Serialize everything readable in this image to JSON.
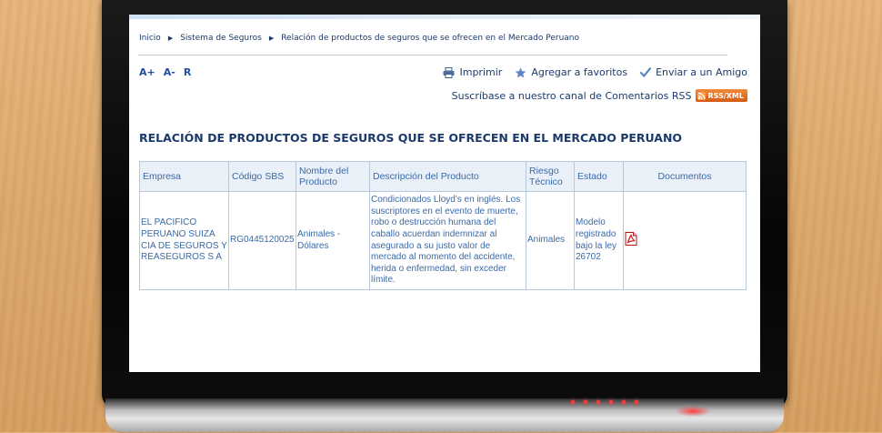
{
  "breadcrumb": [
    "Inicio",
    "Sistema de Seguros",
    "Relación de productos de seguros que se ofrecen en el Mercado Peruano"
  ],
  "font_controls": [
    "A+",
    "A-",
    "R"
  ],
  "actions": {
    "print": "Imprimir",
    "favorites": "Agregar a favoritos",
    "send": "Enviar a un Amigo"
  },
  "rss": {
    "label": "Suscríbase a nuestro canal de Comentarios RSS",
    "badge": "RSS/XML"
  },
  "page_title": "RELACIÓN DE PRODUCTOS DE SEGUROS QUE SE OFRECEN EN EL MERCADO PERUANO",
  "table": {
    "headers": [
      "Empresa",
      "Código SBS",
      "Nombre del Producto",
      "Descripción del Producto",
      "Riesgo Técnico",
      "Estado",
      "Documentos"
    ],
    "rows": [
      {
        "empresa": "EL PACIFICO PERUANO SUIZA CIA DE SEGUROS Y REASEGUROS S A",
        "codigo": "RG0445120025",
        "nombre": "Animales - Dólares",
        "descripcion": "Condicionados Lloyd's en inglés. Los suscriptores en el evento de muerte, robo o destrucción humana del caballo acuerdan indemnizar al asegurado a su justo valor de mercado al momento del accidente, herida o enfermedad, sin exceder límite.",
        "riesgo": "Animales",
        "estado": "Modelo registrado bajo la ley 26702",
        "documento_icon": "pdf-icon"
      }
    ]
  },
  "colors": {
    "link": "#1b3a6b",
    "table_text": "#3a6aa8",
    "header_bg": "#e9f0f8",
    "border": "#b7c8dc",
    "rss_orange": "#e8701f"
  }
}
